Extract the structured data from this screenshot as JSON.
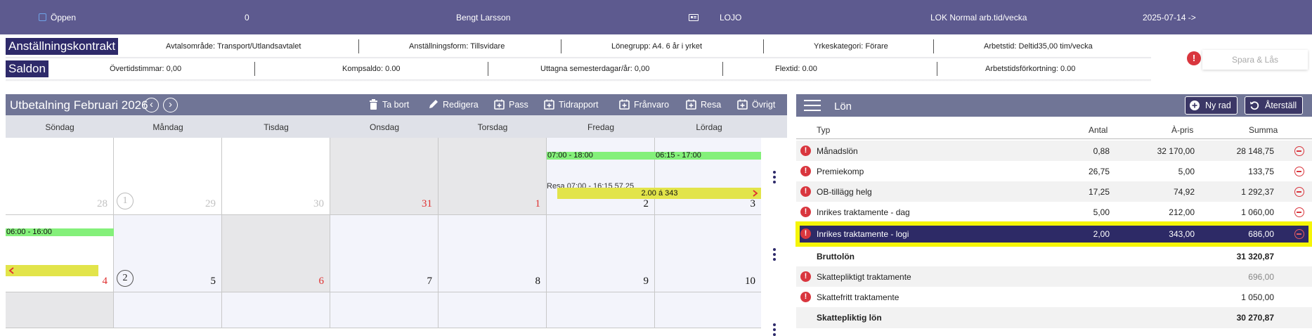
{
  "topbar": {
    "status": "Öppen",
    "count": "0",
    "employee": "Bengt Larsson",
    "location": "LOJO",
    "schedule": "LOK Normal arb.tid/vecka",
    "date": "2025-07-14 ->"
  },
  "contract": {
    "label": "Anställningskontrakt",
    "avtalsomrade": "Avtalsområde: Transport/Utlandsavtalet",
    "anstallningsform": "Anställningsform: Tillsvidare",
    "lonegrupp": "Lönegrupp: A4. 6 år i yrket",
    "yrkeskategori": "Yrkeskategori: Förare",
    "arbetstid": "Arbetstid: Deltid35,00 tim/vecka"
  },
  "saldon": {
    "label": "Saldon",
    "overtid": "Övertidstimmar: 0,00",
    "komp": "Kompsaldo: 0.00",
    "semester": "Uttagna semesterdagar/år: 0,00",
    "flextid": "Flextid: 0.00",
    "arbetstidsforkortning": "Arbetstidsförkortning: 0.00"
  },
  "save_lock": "Spara & Lås",
  "calendar": {
    "title": "Utbetalning Februari 2026",
    "toolbar": {
      "ta_bort": "Ta bort",
      "redigera": "Redigera",
      "pass": "Pass",
      "tidrapport": "Tidrapport",
      "franvaro": "Frånvaro",
      "resa": "Resa",
      "ovrigt": "Övrigt"
    },
    "days": [
      "Söndag",
      "Måndag",
      "Tisdag",
      "Onsdag",
      "Torsdag",
      "Fredag",
      "Lördag"
    ],
    "week1": {
      "week": "1",
      "dates": [
        "28",
        "29",
        "30",
        "31",
        "1",
        "2",
        "3"
      ]
    },
    "week2": {
      "week": "2",
      "dates": [
        "4",
        "5",
        "6",
        "7",
        "8",
        "9",
        "10"
      ]
    },
    "events": {
      "fri_shift": "07:00 - 18:00",
      "sat_shift": "06:15 - 17:00",
      "fri_trip": "Resa 07:00 - 16:15 57,25",
      "trip_bar": "2.00 á 343",
      "sun_shift": "06:00 - 16:00"
    }
  },
  "lon": {
    "title": "Lön",
    "new_row": "Ny rad",
    "reset": "Återställ",
    "columns": {
      "typ": "Typ",
      "antal": "Antal",
      "apris": "À-pris",
      "summa": "Summa"
    },
    "rows": [
      {
        "typ": "Månadslön",
        "antal": "0,88",
        "apris": "32 170,00",
        "summa": "28 148,75"
      },
      {
        "typ": "Premiekomp",
        "antal": "26,75",
        "apris": "5,00",
        "summa": "133,75"
      },
      {
        "typ": "OB-tillägg helg",
        "antal": "17,25",
        "apris": "74,92",
        "summa": "1 292,37"
      },
      {
        "typ": "Inrikes traktamente - dag",
        "antal": "5,00",
        "apris": "212,00",
        "summa": "1 060,00"
      },
      {
        "typ": "Inrikes traktamente - logi",
        "antal": "2,00",
        "apris": "343,00",
        "summa": "686,00"
      }
    ],
    "brutto": {
      "label": "Bruttolön",
      "summa": "31 320,87"
    },
    "skattepliktigt_trakt": {
      "label": "Skattepliktigt traktamente",
      "summa": "696,00"
    },
    "skattefritt_trakt": {
      "label": "Skattefritt traktamente",
      "summa": "1 050,00"
    },
    "skattepliktig_lon": {
      "label": "Skattepliktig lön",
      "summa": "30 270,87"
    }
  },
  "colors": {
    "topbar": "#5d5a8f",
    "header_dark": "#2e2a6a",
    "panel_header": "#707596",
    "selected_row": "#2d2a66",
    "highlight": "#f5f507",
    "shift_green": "#84f07a",
    "trip_yellow": "#e2e44a",
    "alert_red": "#d9363e"
  }
}
